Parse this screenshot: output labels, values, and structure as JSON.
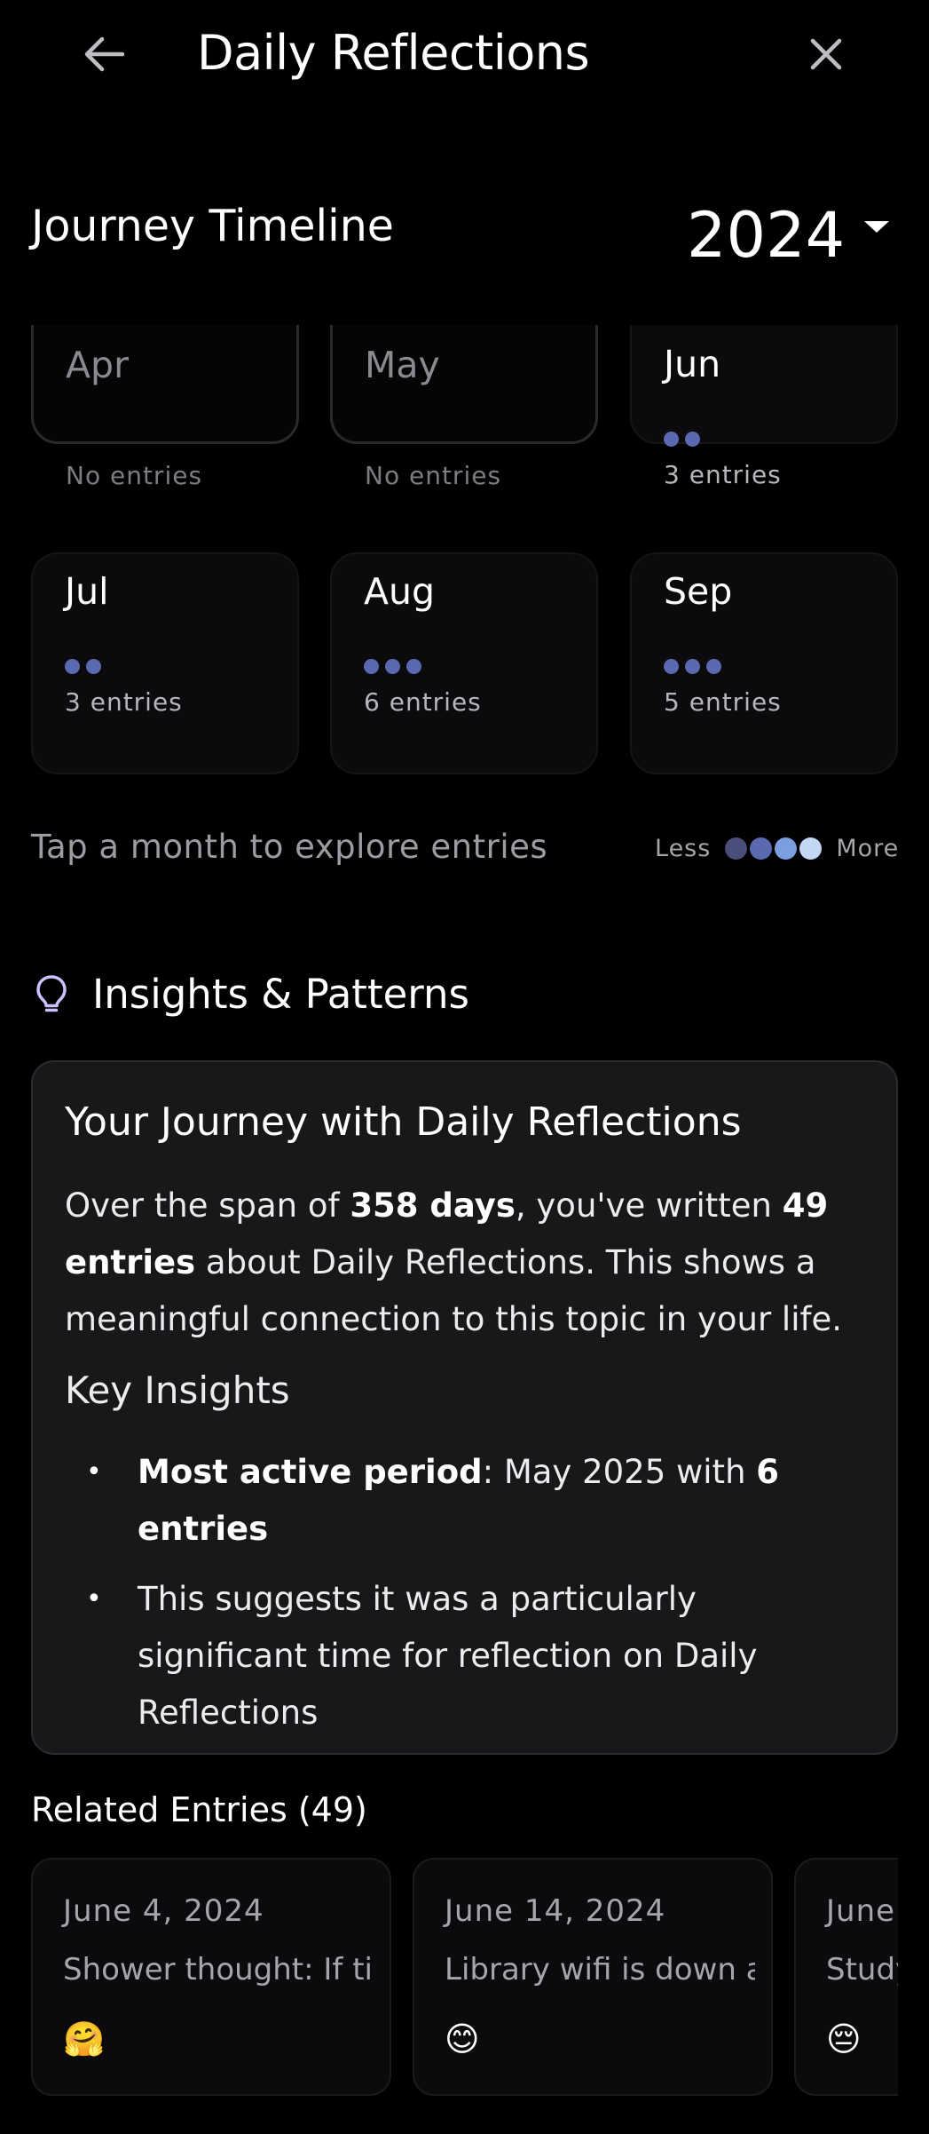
{
  "header": {
    "title": "Daily Reflections",
    "back_icon": "arrow-left-icon",
    "close_icon": "close-icon"
  },
  "timeline": {
    "title": "Journey Timeline",
    "year": "2024",
    "months": [
      {
        "name": "Apr",
        "count": "No entries",
        "dots": 0
      },
      {
        "name": "May",
        "count": "No entries",
        "dots": 0
      },
      {
        "name": "Jun",
        "count": "3 entries",
        "dots": 2
      },
      {
        "name": "Jul",
        "count": "3 entries",
        "dots": 2
      },
      {
        "name": "Aug",
        "count": "6 entries",
        "dots": 3
      },
      {
        "name": "Sep",
        "count": "5 entries",
        "dots": 3
      }
    ],
    "hint": "Tap a month to explore entries",
    "legend": {
      "less": "Less",
      "more": "More",
      "colors": [
        "#4a4e7a",
        "#5b6ab0",
        "#7a9ee0",
        "#c3d7f5"
      ]
    }
  },
  "insights": {
    "title": "Insights & Patterns",
    "icon": "lightbulb-icon",
    "card_title": "Your Journey with Daily Reflections",
    "para": {
      "p1": "Over the span of ",
      "days": "358 days",
      "p2": ", you've written ",
      "entries": "49 entries",
      "p3": " about Daily Reflections. This shows a meaningful connection to this topic in your life."
    },
    "key_title": "Key Insights",
    "bullet1": {
      "bold": "Most active period",
      "text": ": May 2025 with ",
      "bold2": "6 entries"
    },
    "bullet2": "This suggests it was a particularly significant time for reflection on Daily Reflections"
  },
  "related": {
    "title": "Related Entries (49)",
    "entries": [
      {
        "date": "June 4, 2024",
        "text": "Shower thought: If time heals everything",
        "emoji": "🤗"
      },
      {
        "date": "June 14, 2024",
        "text": "Library wifi is down again How am I",
        "emoji": "😊"
      },
      {
        "date": "June",
        "text": "Study strain",
        "emoji": "😔"
      }
    ]
  }
}
